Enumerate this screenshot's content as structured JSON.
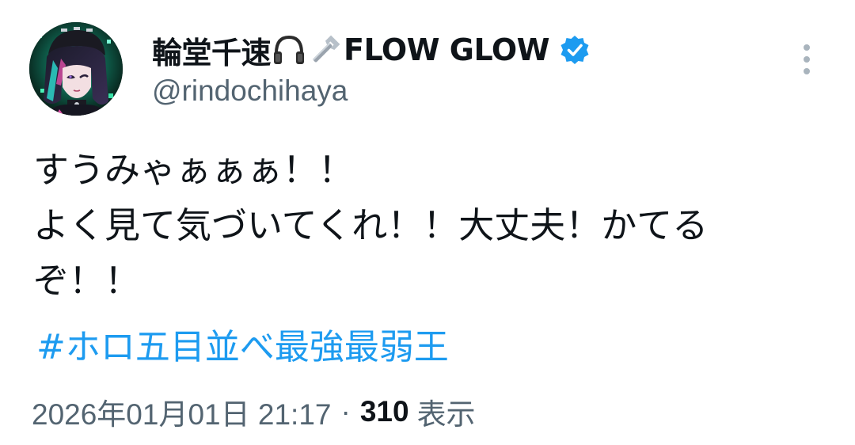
{
  "tweet": {
    "author": {
      "display_name": "輪堂千速",
      "name_suffix": "FLOW GLOW",
      "handle": "@rindochihaya",
      "verified": true,
      "name_emojis": [
        "headphones-emoji",
        "wrench-emoji"
      ]
    },
    "body_lines": [
      "すうみゃぁぁぁ！！",
      "よく見て気づいてくれ！！大丈夫！かてる",
      "ぞ！！"
    ],
    "hashtag": "#ホロ五目並べ最強最弱王",
    "timestamp": "2026年01月01日 21:17",
    "separator": "·",
    "views_count": "310",
    "views_label": "表示"
  },
  "colors": {
    "text_primary": "#0f1419",
    "text_secondary": "#536471",
    "link": "#1d9bf0",
    "verified_badge": "#1d9bf0"
  },
  "icons": {
    "more": "more-vertical-icon",
    "verified": "verified-badge-icon"
  }
}
